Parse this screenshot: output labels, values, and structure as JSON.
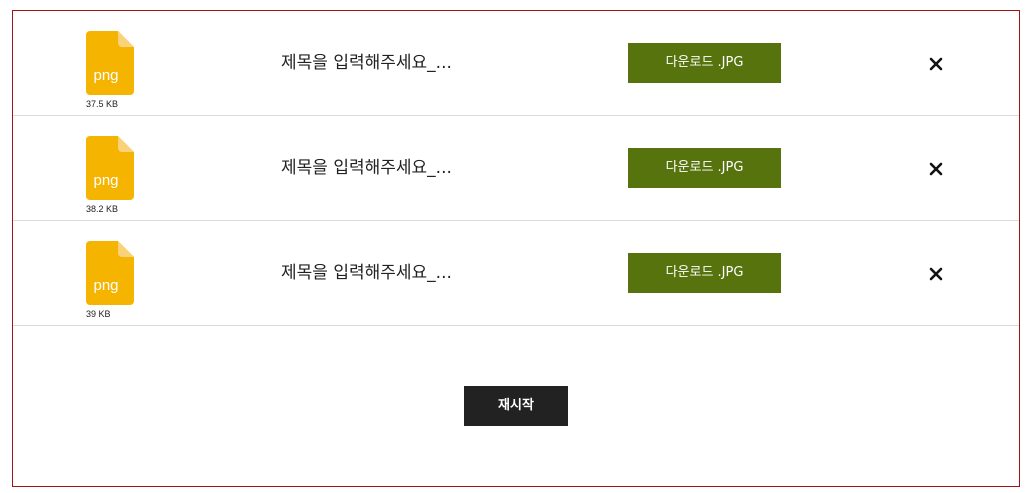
{
  "files": [
    {
      "ext": "png",
      "size": "37.5 KB",
      "title": "제목을 입력해주세요_...",
      "download_label": "다운로드 .JPG",
      "remove_label": "×"
    },
    {
      "ext": "png",
      "size": "38.2 KB",
      "title": "제목을 입력해주세요_...",
      "download_label": "다운로드 .JPG",
      "remove_label": "×"
    },
    {
      "ext": "png",
      "size": "39 KB",
      "title": "제목을 입력해주세요_...",
      "download_label": "다운로드 .JPG",
      "remove_label": "×"
    }
  ],
  "restart_label": "재시작",
  "colors": {
    "panel_border": "#a31515",
    "file_icon": "#f5b400",
    "file_icon_fold": "#f9d27a",
    "download_button": "#56730d",
    "restart_button": "#222222",
    "row_divider": "#dcdcdc"
  },
  "icons": {
    "file": "file-icon",
    "remove": "close-icon"
  }
}
